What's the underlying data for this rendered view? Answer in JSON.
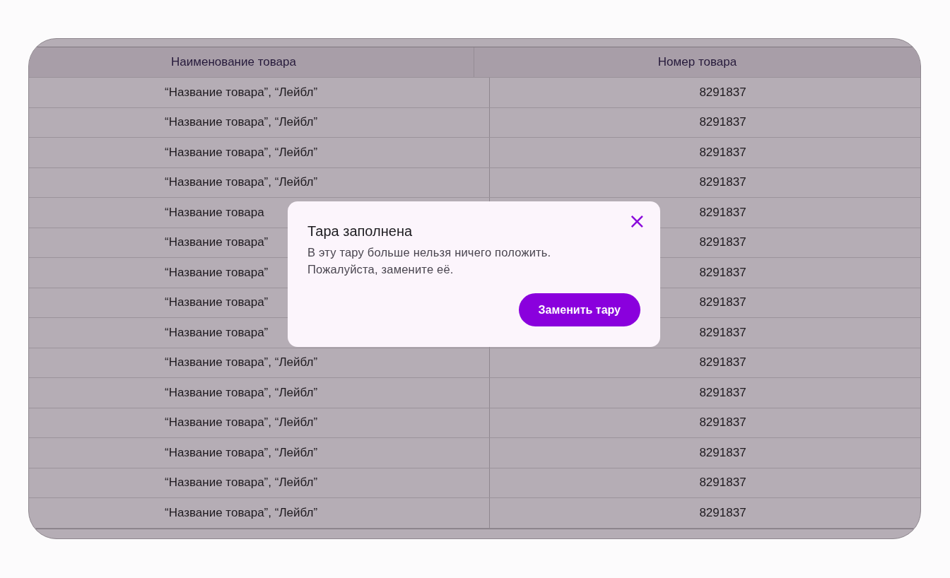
{
  "table": {
    "columns": [
      "Наименование товара",
      "Номер товара"
    ],
    "rows": [
      {
        "name": "“Название товара”, “Лейбл”",
        "number": "8291837"
      },
      {
        "name": "“Название товара”, “Лейбл”",
        "number": "8291837"
      },
      {
        "name": "“Название товара”, “Лейбл”",
        "number": "8291837"
      },
      {
        "name": "“Название товара”, “Лейбл”",
        "number": "8291837"
      },
      {
        "name": "“Название товара",
        "number": "8291837"
      },
      {
        "name": "“Название товара”",
        "number": "8291837"
      },
      {
        "name": "“Название товара”",
        "number": "8291837"
      },
      {
        "name": "“Название товара”",
        "number": "8291837"
      },
      {
        "name": "“Название товара”",
        "number": "8291837"
      },
      {
        "name": "“Название товара”, “Лейбл”",
        "number": "8291837"
      },
      {
        "name": "“Название товара”, “Лейбл”",
        "number": "8291837"
      },
      {
        "name": "“Название товара”, “Лейбл”",
        "number": "8291837"
      },
      {
        "name": "“Название товара”, “Лейбл”",
        "number": "8291837"
      },
      {
        "name": "“Название товара”, “Лейбл”",
        "number": "8291837"
      },
      {
        "name": "“Название товара”, “Лейбл”",
        "number": "8291837"
      }
    ]
  },
  "dialog": {
    "title": "Тара заполнена",
    "message": "В эту тару больше нельзя ничего положить.\nПожалуйста, замените её.",
    "close": "×",
    "action": "Заменить тару"
  }
}
